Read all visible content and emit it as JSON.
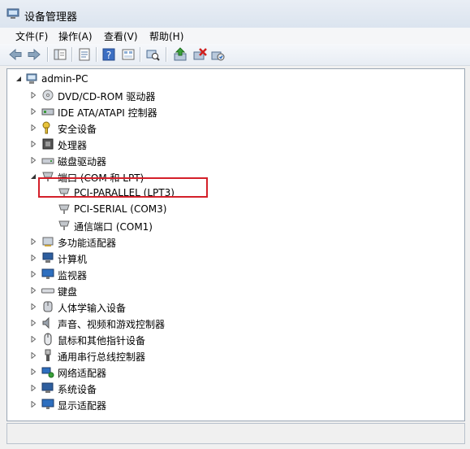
{
  "window": {
    "title": "设备管理器"
  },
  "menu": {
    "file": "文件(F)",
    "action": "操作(A)",
    "view": "查看(V)",
    "help": "帮助(H)"
  },
  "tree": {
    "root": "admin-PC",
    "categories": [
      {
        "label": "DVD/CD-ROM 驱动器"
      },
      {
        "label": "IDE ATA/ATAPI 控制器"
      },
      {
        "label": "安全设备"
      },
      {
        "label": "处理器"
      },
      {
        "label": "磁盘驱动器"
      },
      {
        "label": "端口 (COM 和 LPT)",
        "expanded": true,
        "children": [
          {
            "label": "PCI-PARALLEL (LPT3)"
          },
          {
            "label": "PCI-SERIAL (COM3)"
          },
          {
            "label": "通信端口 (COM1)"
          }
        ]
      },
      {
        "label": "多功能适配器"
      },
      {
        "label": "计算机"
      },
      {
        "label": "监视器"
      },
      {
        "label": "键盘"
      },
      {
        "label": "人体学输入设备"
      },
      {
        "label": "声音、视频和游戏控制器"
      },
      {
        "label": "鼠标和其他指针设备"
      },
      {
        "label": "通用串行总线控制器"
      },
      {
        "label": "网络适配器"
      },
      {
        "label": "系统设备"
      },
      {
        "label": "显示适配器"
      }
    ]
  },
  "colors": {
    "highlight_box": "#d4202a",
    "tree_bg": "#ffffff",
    "chrome": "#f0f0f0"
  }
}
